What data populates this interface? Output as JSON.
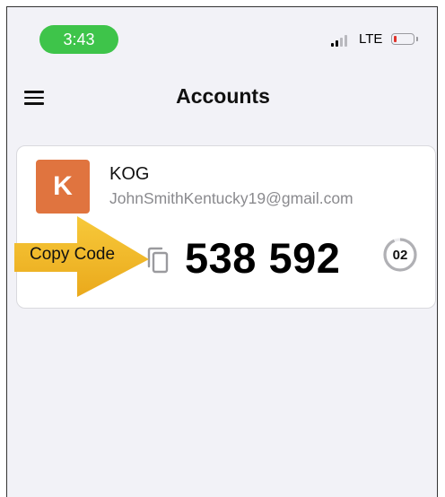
{
  "status_bar": {
    "time": "3:43",
    "network": "LTE",
    "icons": [
      "signal-icon",
      "battery-icon"
    ]
  },
  "nav": {
    "title": "Accounts",
    "menu_icon": "hamburger-menu-icon"
  },
  "account": {
    "avatar_letter": "K",
    "name": "KOG",
    "email": "JohnSmithKentucky19@gmail.com",
    "code": "538 592",
    "timer_seconds": "02",
    "copy_icon": "copy-icon"
  },
  "annotation": {
    "label": "Copy Code"
  },
  "colors": {
    "time_pill": "#3ec44a",
    "avatar": "#e0743f",
    "arrow": "#f2b724",
    "background": "#f2f2f7"
  }
}
